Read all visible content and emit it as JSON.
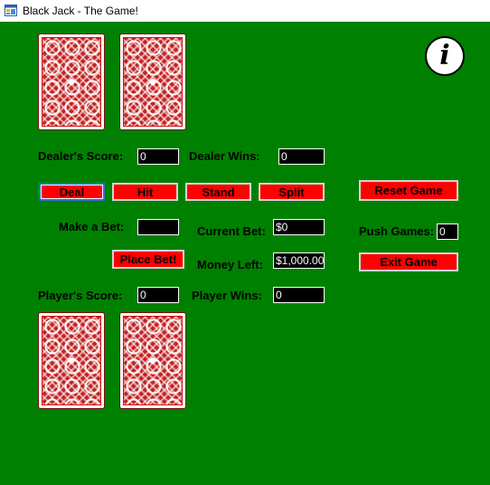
{
  "window": {
    "title": "Black Jack - The Game!"
  },
  "colors": {
    "felt": "#008000",
    "button": "#ff0000",
    "field_bg": "#000000",
    "field_text": "#ffffff"
  },
  "icons": {
    "app": "app-window-icon",
    "info": "info-icon",
    "card_back": "card-back"
  },
  "info_glyph": "i",
  "dealer": {
    "score_label": "Dealer's Score:",
    "score": "0",
    "wins_label": "Dealer Wins:",
    "wins": "0",
    "cards_shown": 2
  },
  "buttons": {
    "deal": "Deal",
    "hit": "Hit",
    "stand": "Stand",
    "split": "Split",
    "reset": "Reset Game",
    "place_bet": "Place Bet!",
    "exit": "Exit Game"
  },
  "bet": {
    "make_label": "Make a Bet:",
    "make_value": "",
    "current_label": "Current Bet:",
    "current_value": "$0",
    "money_label": "Money Left:",
    "money_value": "$1,000.00"
  },
  "push": {
    "label": "Push Games:",
    "value": "0"
  },
  "player": {
    "score_label": "Player's Score:",
    "score": "0",
    "wins_label": "Player Wins:",
    "wins": "0",
    "cards_shown": 2
  }
}
